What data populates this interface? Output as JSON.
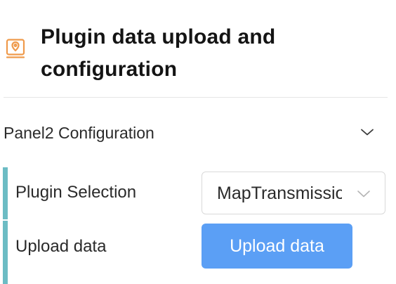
{
  "header": {
    "icon": "map-pin-frame-icon",
    "title": "Plugin data upload and configuration",
    "icon_color": "#ef9a4b"
  },
  "panel": {
    "title": "Panel2 Configuration",
    "chevron_icon": "chevron-down-icon",
    "expanded": true
  },
  "rows": {
    "plugin_selection": {
      "label": "Plugin Selection",
      "selected_value": "MapTransmission",
      "chevron_icon": "chevron-down-icon"
    },
    "upload_data": {
      "label": "Upload data",
      "button_label": "Upload data"
    }
  },
  "colors": {
    "accent_bar": "#6cbcc4",
    "button": "#5b9ff5",
    "button_text": "#ffffff",
    "divider": "#e6e6e6"
  }
}
